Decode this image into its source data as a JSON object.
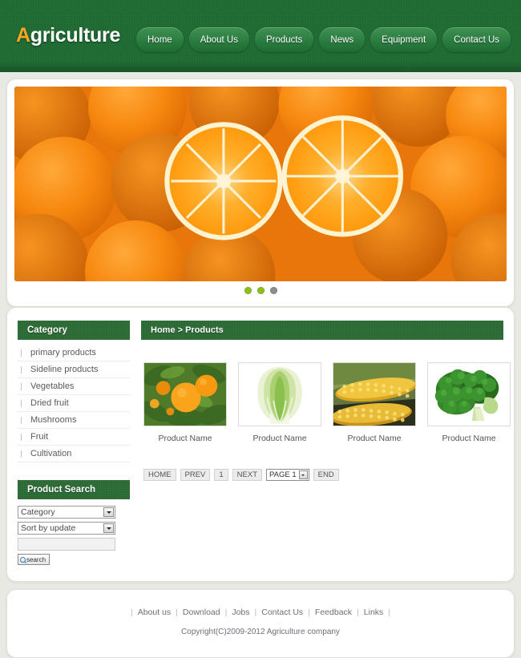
{
  "header": {
    "logo_accent": "A",
    "logo_rest": "griculture",
    "nav": [
      {
        "label": "Home"
      },
      {
        "label": "About Us"
      },
      {
        "label": "Products"
      },
      {
        "label": "News"
      },
      {
        "label": "Equipment"
      },
      {
        "label": "Contact Us"
      }
    ]
  },
  "hero": {
    "alt": "oranges-banner-image",
    "dots": [
      {
        "state": "active"
      },
      {
        "state": "active"
      },
      {
        "state": "inactive"
      }
    ]
  },
  "sidebar": {
    "category": {
      "title": "Category",
      "items": [
        {
          "label": "primary products"
        },
        {
          "label": "Sideline products"
        },
        {
          "label": "Vegetables"
        },
        {
          "label": "Dried fruit"
        },
        {
          "label": "Mushrooms"
        },
        {
          "label": "Fruit"
        },
        {
          "label": "Cultivation"
        }
      ]
    },
    "search": {
      "title": "Product Search",
      "category_value": "Category",
      "sort_value": "Sort by update",
      "keyword_value": "",
      "keyword_placeholder": "",
      "button_label": "search"
    }
  },
  "content": {
    "breadcrumb": "Home > Products",
    "products": [
      {
        "name": "Product Name",
        "image": "oranges-on-tree"
      },
      {
        "name": "Product Name",
        "image": "napa-cabbage"
      },
      {
        "name": "Product Name",
        "image": "corn-cobs"
      },
      {
        "name": "Product Name",
        "image": "broccoli"
      }
    ],
    "pagination": {
      "home": "HOME",
      "prev": "PREV",
      "current": "1",
      "next": "NEXT",
      "page_select": "PAGE 1",
      "end": "END"
    }
  },
  "footer": {
    "links": [
      {
        "label": "About us"
      },
      {
        "label": "Download"
      },
      {
        "label": "Jobs"
      },
      {
        "label": "Contact Us"
      },
      {
        "label": "Feedback"
      },
      {
        "label": "Links"
      }
    ],
    "copyright": "Copyright(C)2009-2012 Agriculture company"
  },
  "colors": {
    "brand_green": "#1f6b33",
    "header_green": "#2c6b36",
    "logo_accent": "#f5a623",
    "dot_active": "#8fbf1f",
    "dot_inactive": "#8d8d8d"
  }
}
